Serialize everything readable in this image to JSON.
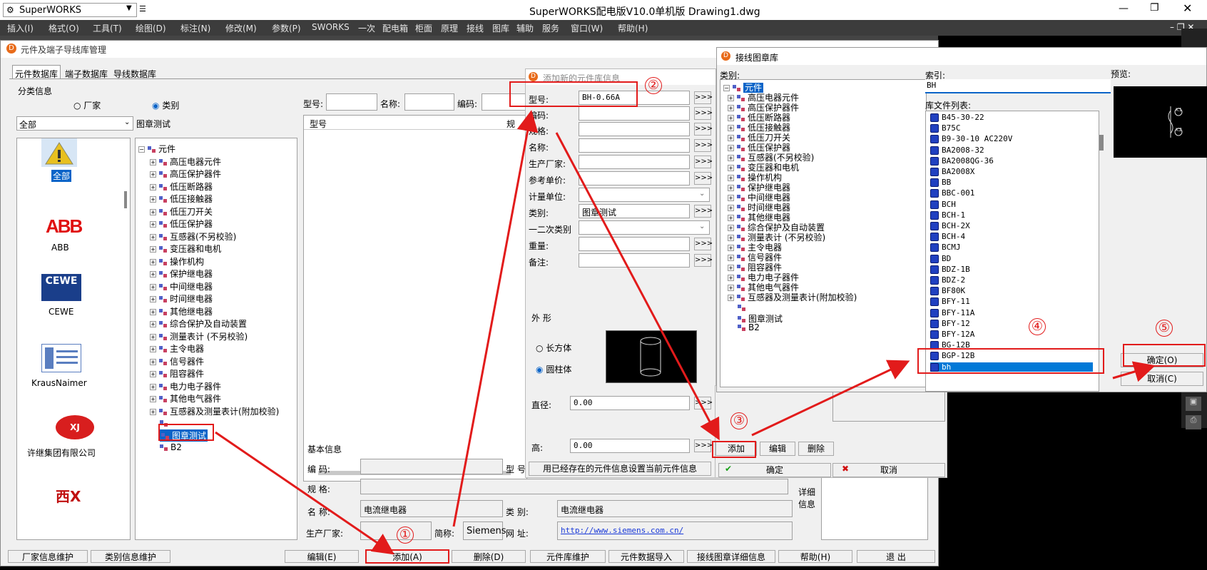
{
  "titlebar": {
    "app_combo": "SuperWORKS",
    "title": "SuperWORKS配电版V10.0单机版    Drawing1.dwg",
    "minimize": "—",
    "maximize": "❐",
    "close": "✕"
  },
  "menu": [
    "插入(I)",
    "格式(O)",
    "工具(T)",
    "绘图(D)",
    "标注(N)",
    "修改(M)",
    "参数(P)",
    "SWORKS",
    "一次",
    "配电箱",
    "柜面",
    "原理",
    "接线",
    "图库",
    "辅助",
    "服务",
    "窗口(W)",
    "帮助(H)"
  ],
  "main": {
    "title": "元件及端子导线库管理",
    "tabs": [
      "元件数据库",
      "端子数据库",
      "导线数据库"
    ],
    "group": "分类信息",
    "radio_factory": "厂家",
    "radio_category": "类别",
    "combo_all": "全部",
    "category_label": "图章测试",
    "brands": [
      "全部",
      "ABB",
      "CEWE",
      "KrausNaimer",
      "许继集团有限公司"
    ],
    "search_labels": [
      "型号:",
      "名称:",
      "编码:"
    ],
    "table_header": [
      "型号",
      "规"
    ],
    "tree_root": "元件",
    "tree_items": [
      "高压电器元件",
      "高压保护器件",
      "低压断路器",
      "低压接触器",
      "低压刀开关",
      "低压保护器",
      "互感器(不另校验)",
      "变压器和电机",
      "操作机构",
      "保护继电器",
      "中间继电器",
      "时间继电器",
      "其他继电器",
      "综合保护及自动装置",
      "测量表计 (不另校验)",
      "主令电器",
      "信号器件",
      "阻容器件",
      "电力电子器件",
      "其他电气器件",
      "互感器及测量表计(附加校验)"
    ],
    "tree_selected": "图章测试",
    "tree_last": "B2",
    "basic_info": "基本信息",
    "basic_labels": [
      "编  码:",
      "规  格:",
      "名  称:",
      "生产厂家:",
      "简称:",
      "型  号",
      "类  别:",
      "网  址:",
      "详细信息"
    ],
    "basic_values": {
      "name": "电流继电器",
      "category": "电流继电器",
      "short": "Siemens",
      "url": "http://www.siemens.com.cn/"
    },
    "buttons": [
      "厂家信息维护",
      "类别信息维护",
      "编辑(E)",
      "添加(A)",
      "删除(D)",
      "元件库维护",
      "元件数据导入",
      "接线图章详细信息",
      "帮助(H)",
      "退    出"
    ]
  },
  "add_dialog": {
    "title": "添加新的元件库信息",
    "labels": [
      "型号:",
      "编码:",
      "规格:",
      "名称:",
      "生产厂家:",
      "参考单价:",
      "计量单位:",
      "类别:",
      "一二次类别",
      "重量:",
      "备注:"
    ],
    "values": {
      "model": "BH-0.66A",
      "category": "图章测试"
    },
    "shape_label": "外    形",
    "shape_options": [
      "长方体",
      "圆柱体"
    ],
    "diameter_label": "直径:",
    "diameter": "0.00",
    "height_label": "高:",
    "height": "0.00",
    "ellipsis": ">>>",
    "use_existing": "用已经存在的元件信息设置当前元件信息",
    "add": "添加",
    "edit": "编辑",
    "delete": "删除",
    "ok": "确定",
    "cancel": "取消"
  },
  "wiring_dialog": {
    "title": "接线图章库",
    "category_label": "类别:",
    "index_label": "索引:",
    "index_value": "BH",
    "preview_label": "预览:",
    "list_label": "库文件列表:",
    "tree_root": "元件",
    "tree_items": [
      "高压电器元件",
      "高压保护器件",
      "低压断路器",
      "低压接触器",
      "低压刀开关",
      "低压保护器",
      "互感器(不另校验)",
      "变压器和电机",
      "操作机构",
      "保护继电器",
      "中间继电器",
      "时间继电器",
      "其他继电器",
      "综合保护及自动装置",
      "测量表计 (不另校验)",
      "主令电器",
      "信号器件",
      "阻容器件",
      "电力电子器件",
      "其他电气器件",
      "互感器及测量表计(附加校验)",
      "图章测试",
      "B2"
    ],
    "files": [
      "B45-30-22",
      "B75C",
      "B9-30-10 AC220V",
      "BA2008-32",
      "BA2008QG-36",
      "BA2008X",
      "BB",
      "BBC-001",
      "BCH",
      "BCH-1",
      "BCH-2X",
      "BCH-4",
      "BCMJ",
      "BD",
      "BDZ-1B",
      "BDZ-2",
      "BF80K",
      "BFY-11",
      "BFY-11A",
      "BFY-12",
      "BFY-12A",
      "BG-12B",
      "BGP-12B",
      "bh"
    ],
    "selected_file": "bh",
    "preview_labels": [
      "K1",
      "K2"
    ],
    "ok": "确定(O)",
    "cancel": "取消(C)"
  },
  "markers": [
    "①",
    "②",
    "③",
    "④",
    "⑤"
  ],
  "colors": {
    "annotation": "#e21b1b",
    "selection": "#0078d7",
    "cad_bg": "#000000"
  }
}
